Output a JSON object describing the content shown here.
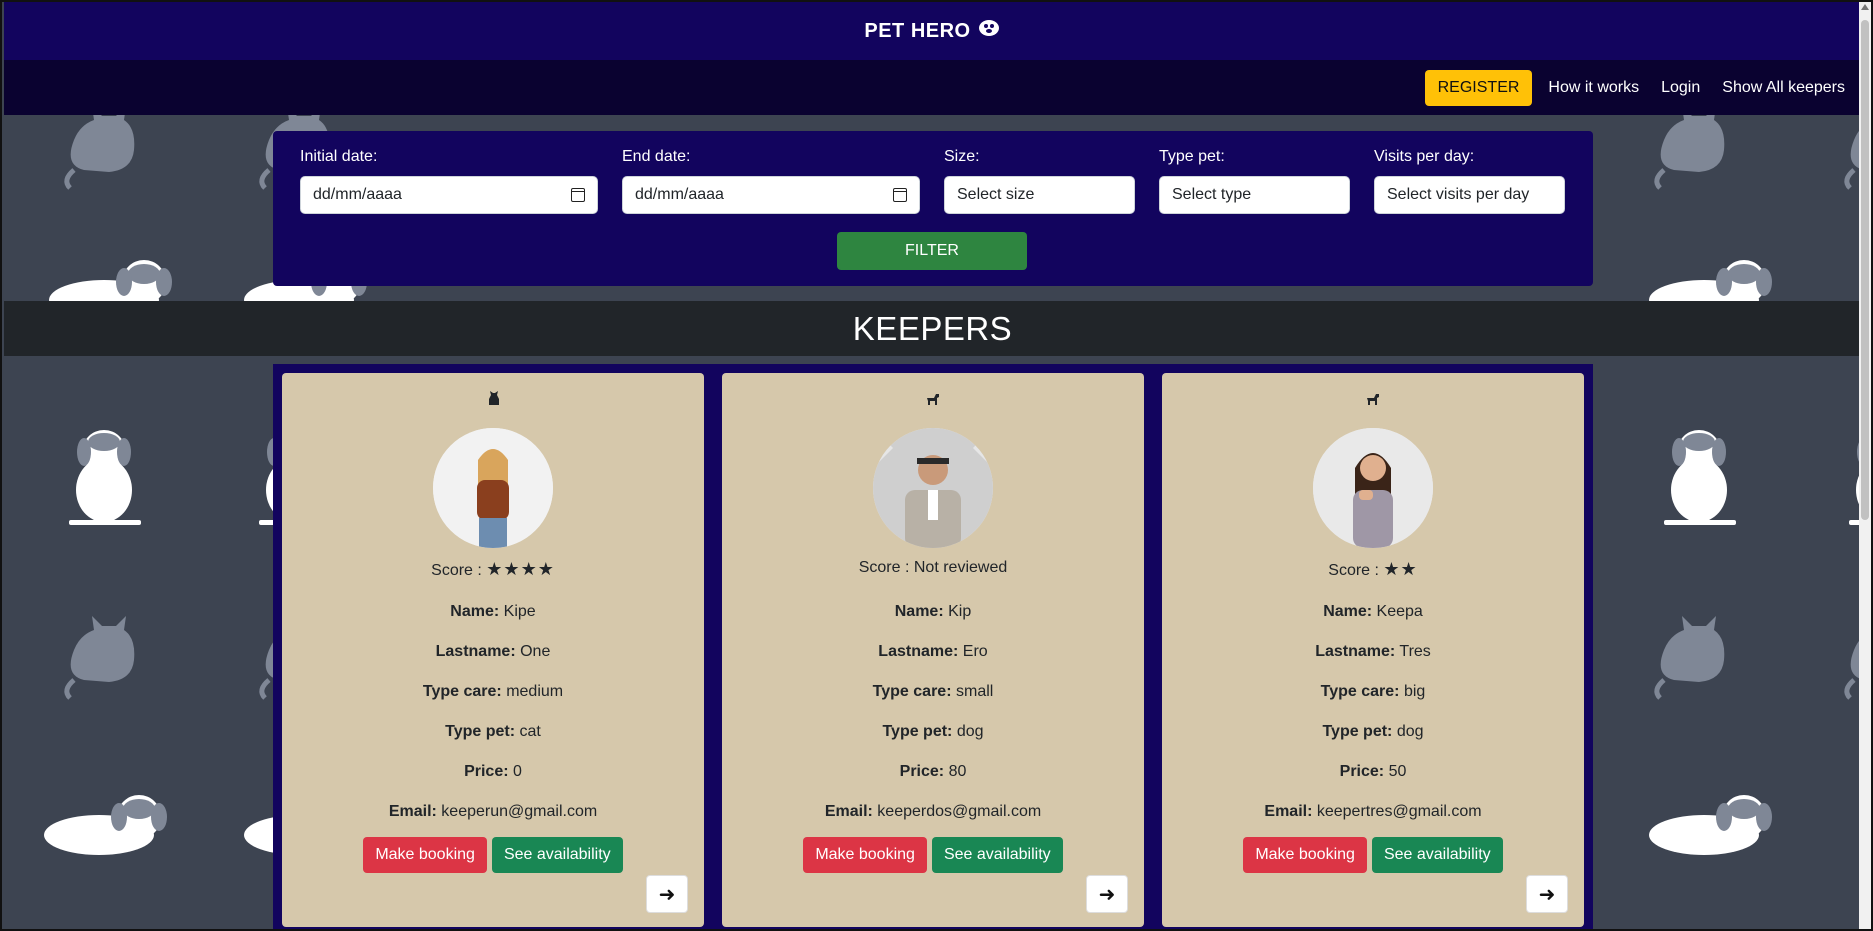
{
  "header": {
    "brand": "PET HERO",
    "logo_icon": "paw-glyph"
  },
  "nav": {
    "register": "REGISTER",
    "how_it_works": "How it works",
    "login": "Login",
    "show_all": "Show All keepers"
  },
  "filter": {
    "initial_label": "Initial date:",
    "initial_placeholder": "dd/mm/aaaa",
    "end_label": "End date:",
    "end_placeholder": "dd/mm/aaaa",
    "size_label": "Size:",
    "size_value": "Select size",
    "type_label": "Type pet:",
    "type_value": "Select type",
    "visits_label": "Visits per day:",
    "visits_value": "Select visits per day",
    "button": "FILTER"
  },
  "section_title": "KEEPERS",
  "labels": {
    "score": "Score :",
    "name": "Name:",
    "lastname": "Lastname:",
    "type_care": "Type care:",
    "type_pet": "Type pet:",
    "price": "Price:",
    "email": "Email:",
    "make_booking": "Make booking",
    "see_availability": "See availability"
  },
  "keepers": [
    {
      "pet_icon": "cat-icon",
      "score": "★★★★",
      "name": "Kipe",
      "lastname": "One",
      "type_care": "medium",
      "type_pet": "cat",
      "price": "0",
      "email": "keeperun@gmail.com"
    },
    {
      "pet_icon": "dog-icon",
      "score": "Not reviewed",
      "name": "Kip",
      "lastname": "Ero",
      "type_care": "small",
      "type_pet": "dog",
      "price": "80",
      "email": "keeperdos@gmail.com"
    },
    {
      "pet_icon": "dog-icon",
      "score": "★★",
      "name": "Keepa",
      "lastname": "Tres",
      "type_care": "big",
      "type_pet": "dog",
      "price": "50",
      "email": "keepertres@gmail.com"
    }
  ],
  "colors": {
    "header": "#12045e",
    "nav": "#0a0230",
    "register": "#ffc107",
    "card": "#d6c8ab",
    "filter_btn": "#2e8540"
  }
}
